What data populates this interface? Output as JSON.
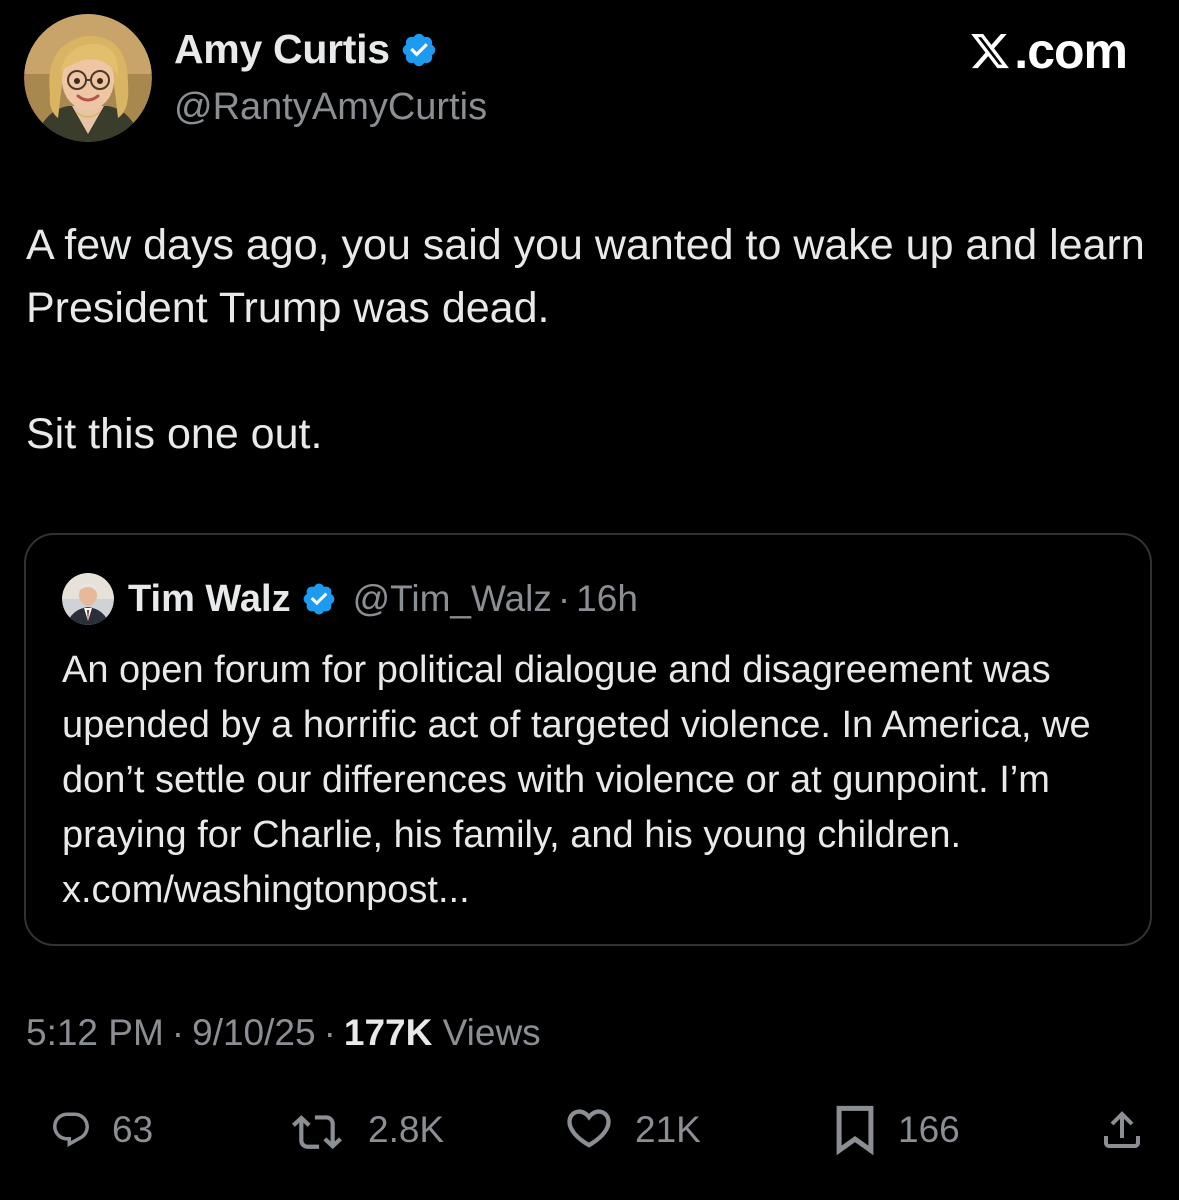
{
  "brand": {
    "label": ".com"
  },
  "author": {
    "name": "Amy Curtis",
    "handle": "@RantyAmyCurtis",
    "verified": true
  },
  "tweet": {
    "paragraphs": [
      "A few days ago, you said you wanted to wake up and learn President Trump was dead.",
      "Sit this one out."
    ]
  },
  "quoted_tweet": {
    "author_name": "Tim Walz",
    "handle": "@Tim_Walz",
    "separator": "·",
    "age": "16h",
    "verified": true,
    "text": "An open forum for political dialogue and disagreement was upended by a horrific act of targeted violence. In America, we don’t settle our differences with violence or at gunpoint. I’m praying for Charlie, his family, and his young children. x.com/washingtonpost..."
  },
  "meta": {
    "time": "5:12 PM",
    "separator": "·",
    "date": "9/10/25",
    "views_count": "177K",
    "views_label": "Views"
  },
  "actions": {
    "replies": "63",
    "reposts": "2.8K",
    "likes": "21K",
    "bookmarks": "166"
  },
  "colors": {
    "background": "#000000",
    "text": "#e7e9ea",
    "secondary_text": "#8b8f94",
    "verified_blue": "#1d9bf0",
    "border": "#2f3336"
  },
  "icons": {
    "reply": "speech-bubble-icon",
    "repost": "repost-arrows-icon",
    "like": "heart-icon",
    "bookmark": "bookmark-icon",
    "share": "share-upload-icon",
    "verified": "verified-badge-icon"
  }
}
